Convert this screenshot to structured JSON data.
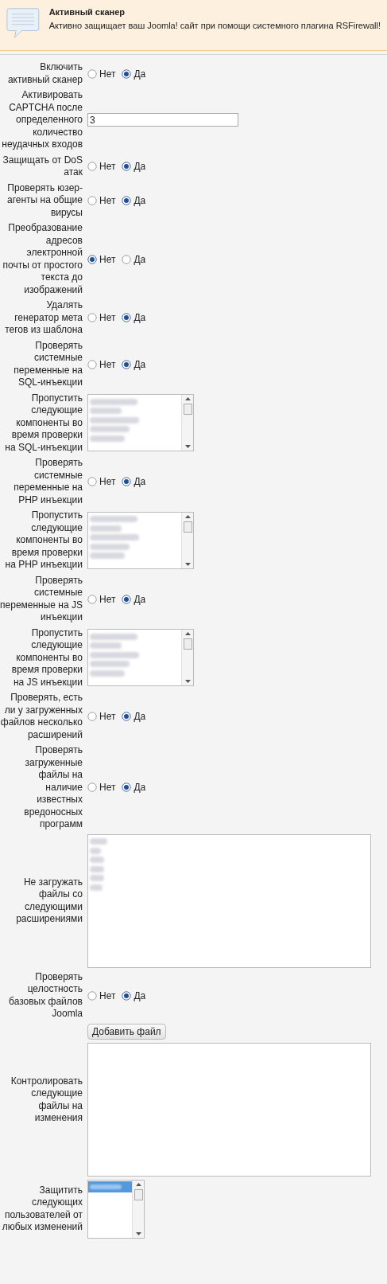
{
  "header": {
    "title": "Активный сканер",
    "description": "Активно защищает ваш Joomla! сайт при помощи системного плагина RSFirewall!"
  },
  "rows": [
    {
      "kind": "radio",
      "label": "Включить активный сканер",
      "options": [
        {
          "label": "Нет",
          "selected": false
        },
        {
          "label": "Да",
          "selected": true
        }
      ]
    },
    {
      "kind": "text",
      "label": "Активировать CAPTCHA после определенного количество неудачных входов",
      "value": "3"
    },
    {
      "kind": "radio",
      "label": "Защищать от DoS атак",
      "options": [
        {
          "label": "Нет",
          "selected": false
        },
        {
          "label": "Да",
          "selected": true
        }
      ]
    },
    {
      "kind": "radio",
      "label": "Проверять юзер-агенты на общие вирусы",
      "options": [
        {
          "label": "Нет",
          "selected": false
        },
        {
          "label": "Да",
          "selected": true
        }
      ]
    },
    {
      "kind": "radio",
      "label": "Преобразование адресов электронной почты от простого текста до изображений",
      "options": [
        {
          "label": "Нет",
          "selected": true
        },
        {
          "label": "Да",
          "selected": false
        }
      ]
    },
    {
      "kind": "radio",
      "label": "Удалять генератор мета тегов из шаблона",
      "options": [
        {
          "label": "Нет",
          "selected": false
        },
        {
          "label": "Да",
          "selected": true
        }
      ]
    },
    {
      "kind": "radio",
      "label": "Проверять системные переменные на SQL-инъекции",
      "options": [
        {
          "label": "Нет",
          "selected": false
        },
        {
          "label": "Да",
          "selected": true
        }
      ]
    },
    {
      "kind": "listbox",
      "label": "Пропустить следующие компоненты во время проверки на SQL-инъекции"
    },
    {
      "kind": "radio",
      "label": "Проверять системные переменные на PHP инъекции",
      "options": [
        {
          "label": "Нет",
          "selected": false
        },
        {
          "label": "Да",
          "selected": true
        }
      ]
    },
    {
      "kind": "listbox",
      "label": "Пропустить следующие компоненты во время проверки на PHP инъекции"
    },
    {
      "kind": "radio",
      "label": "Проверять системные переменные на JS инъекции",
      "options": [
        {
          "label": "Нет",
          "selected": false
        },
        {
          "label": "Да",
          "selected": true
        }
      ]
    },
    {
      "kind": "listbox",
      "label": "Пропустить следующие компоненты во время проверки на JS инъекции"
    },
    {
      "kind": "radio",
      "label": "Проверять, есть ли у загруженных файлов несколько расширений",
      "options": [
        {
          "label": "Нет",
          "selected": false
        },
        {
          "label": "Да",
          "selected": true
        }
      ]
    },
    {
      "kind": "radio",
      "label": "Проверять загруженные файлы на наличие известных вредоносных программ",
      "options": [
        {
          "label": "Нет",
          "selected": false
        },
        {
          "label": "Да",
          "selected": true
        }
      ]
    },
    {
      "kind": "extensions",
      "label": "Не загружать файлы со следующими расширениями"
    },
    {
      "kind": "radio",
      "label": "Проверять целостность базовых файлов Joomla",
      "options": [
        {
          "label": "Нет",
          "selected": false
        },
        {
          "label": "Да",
          "selected": true
        }
      ]
    },
    {
      "kind": "files",
      "label": "Контролировать следующие файлы на изменения",
      "button": "Добавить файл"
    },
    {
      "kind": "users",
      "label": "Защитить следующих пользователей от любых изменений"
    }
  ]
}
